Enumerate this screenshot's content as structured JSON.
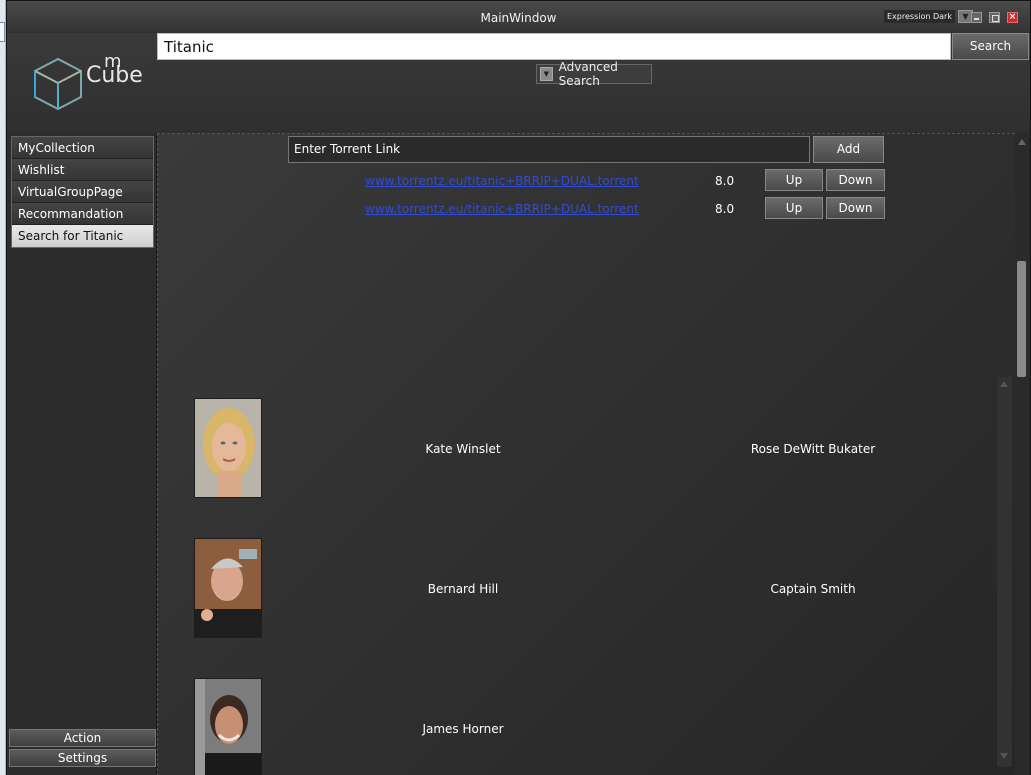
{
  "window": {
    "title": "MainWindow",
    "theme": "Expression Dark"
  },
  "logo": {
    "m": "m",
    "cube": "Cube"
  },
  "search": {
    "value": "Titanic",
    "button": "Search",
    "advanced": "Advanced Search"
  },
  "sidebar": {
    "items": [
      {
        "label": "MyCollection"
      },
      {
        "label": "Wishlist"
      },
      {
        "label": "VirtualGroupPage"
      },
      {
        "label": "Recommandation"
      },
      {
        "label": "Search for Titanic"
      }
    ],
    "selected_index": 4,
    "action": "Action",
    "settings": "Settings"
  },
  "torrents": {
    "input_placeholder": "Enter Torrent Link",
    "add": "Add",
    "rows": [
      {
        "link": "www.torrentz.eu/titanic+BRRIP+DUAL.torrent",
        "rating": "8.0",
        "up": "Up",
        "down": "Down"
      },
      {
        "link": "www.torrentz.eu/titanic+BRRIP+DUAL.torrent",
        "rating": "8.0",
        "up": "Up",
        "down": "Down"
      }
    ]
  },
  "cast": [
    {
      "actor": "Kate Winslet",
      "role": "Rose DeWitt Bukater"
    },
    {
      "actor": "Bernard Hill",
      "role": "Captain Smith"
    },
    {
      "actor": "James Horner",
      "role": ""
    }
  ],
  "colors": {
    "link": "#2f4bd8",
    "background": "#2b2b2b",
    "selected_nav": "#d9d9d9"
  }
}
